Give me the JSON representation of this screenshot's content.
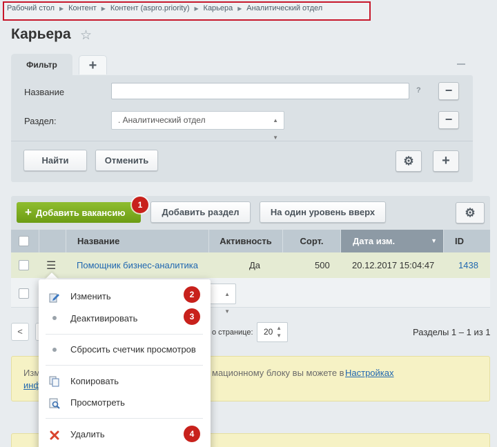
{
  "breadcrumb": [
    "Рабочий стол",
    "Контент",
    "Контент (aspro.priority)",
    "Карьера",
    "Аналитический отдел"
  ],
  "page_title": "Карьера",
  "filter": {
    "tab_label": "Фильтр",
    "add_tab": "+",
    "name_label": "Название",
    "name_value": "",
    "help": "?",
    "section_label": "Раздел:",
    "section_value": ". Аналитический отдел",
    "find_button": "Найти",
    "cancel_button": "Отменить"
  },
  "toolbar": {
    "add_vacancy": "Добавить вакансию",
    "add_section": "Добавить раздел",
    "level_up": "На один уровень вверх"
  },
  "badges": [
    "1",
    "2",
    "3",
    "4"
  ],
  "table": {
    "columns": [
      "Название",
      "Активность",
      "Сорт.",
      "Дата изм.",
      "ID"
    ],
    "rows": [
      {
        "name": "Помощник бизнес-аналитика",
        "active": "Да",
        "sort": "500",
        "date": "20.12.2017 15:04:47",
        "id": "1438"
      }
    ]
  },
  "pager": {
    "prev": "<",
    "per_page_label": "о странице:",
    "per_page_value": "20",
    "summary": "Разделы 1 – 1 из 1"
  },
  "notice": {
    "line1_start": "Изм",
    "line1_end": "мационному блоку вы можете в",
    "link1": "Настройках",
    "line2_link": "инф"
  },
  "context_menu": {
    "items": [
      "Изменить",
      "Деактивировать",
      "Сбросить счетчик просмотров",
      "Копировать",
      "Просмотреть",
      "Удалить"
    ]
  },
  "colors": {
    "accent_green": "#7aab1e",
    "badge_red": "#c8211c",
    "link_blue": "#2067b0",
    "highlight_border": "#c7172a"
  }
}
